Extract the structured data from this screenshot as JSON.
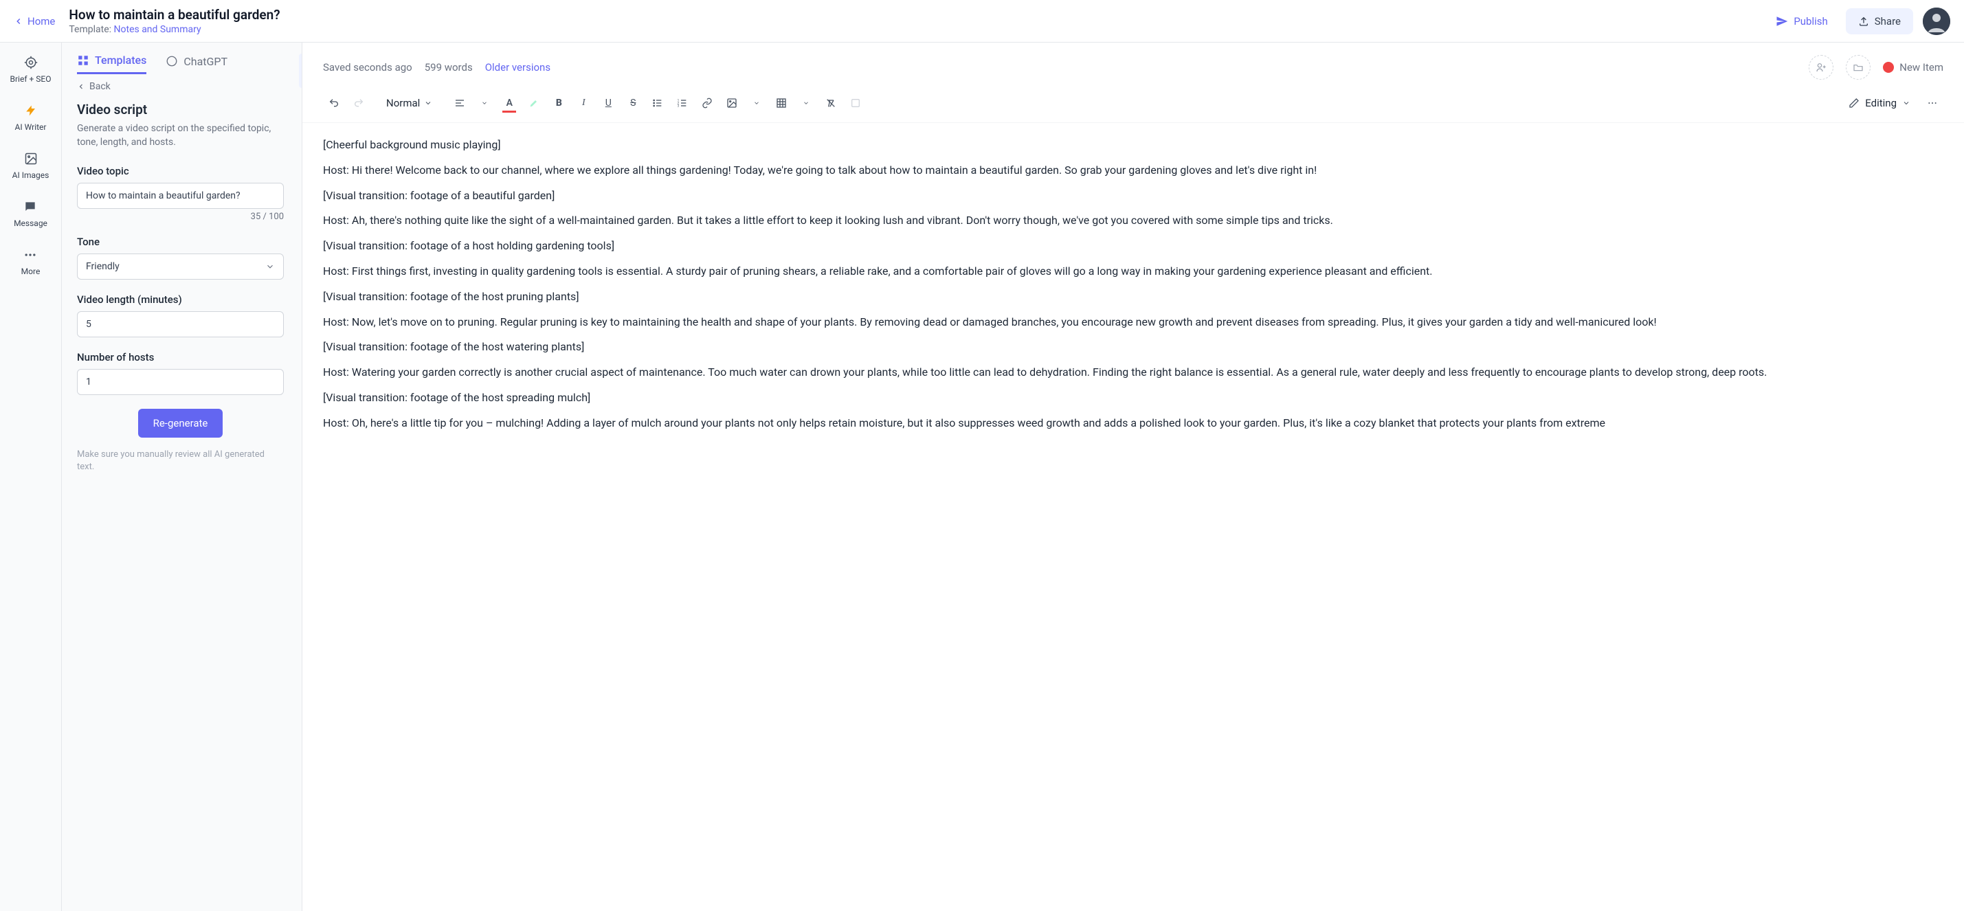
{
  "header": {
    "home": "Home",
    "title": "How to maintain a beautiful garden?",
    "template_prefix": "Template: ",
    "template_link": "Notes and Summary",
    "publish": "Publish",
    "share": "Share"
  },
  "rail": {
    "items": [
      {
        "label": "Brief + SEO"
      },
      {
        "label": "AI Writer"
      },
      {
        "label": "AI Images"
      },
      {
        "label": "Message"
      },
      {
        "label": "More"
      }
    ]
  },
  "panel": {
    "tabs": {
      "templates": "Templates",
      "chatgpt": "ChatGPT"
    },
    "back": "Back",
    "title": "Video script",
    "desc": "Generate a video script on the specified topic, tone, length, and hosts.",
    "topic_label": "Video topic",
    "topic_value": "How to maintain a beautiful garden?",
    "char_count": "35 / 100",
    "tone_label": "Tone",
    "tone_value": "Friendly",
    "length_label": "Video length (minutes)",
    "length_value": "5",
    "hosts_label": "Number of hosts",
    "hosts_value": "1",
    "regen": "Re-generate",
    "disclaimer": "Make sure you manually review all AI generated text."
  },
  "status": {
    "saved": "Saved seconds ago",
    "words": "599 words",
    "older": "Older versions",
    "new_item": "New Item"
  },
  "toolbar": {
    "style": "Normal",
    "editing": "Editing"
  },
  "doc": {
    "p1": "[Cheerful background music playing]",
    "p2": "Host: Hi there! Welcome back to our channel, where we explore all things gardening! Today, we're going to talk about how to maintain a beautiful garden. So grab your gardening gloves and let's dive right in!",
    "p3": "[Visual transition: footage of a beautiful garden]",
    "p4": "Host: Ah, there's nothing quite like the sight of a well-maintained garden. But it takes a little effort to keep it looking lush and vibrant. Don't worry though, we've got you covered with some simple tips and tricks.",
    "p5": "[Visual transition: footage of a host holding gardening tools]",
    "p6": "Host: First things first, investing in quality gardening tools is essential. A sturdy pair of pruning shears, a reliable rake, and a comfortable pair of gloves will go a long way in making your gardening experience pleasant and efficient.",
    "p7": "[Visual transition: footage of the host pruning plants]",
    "p8": "Host: Now, let's move on to pruning. Regular pruning is key to maintaining the health and shape of your plants. By removing dead or damaged branches, you encourage new growth and prevent diseases from spreading. Plus, it gives your garden a tidy and well-manicured look!",
    "p9": "[Visual transition: footage of the host watering plants]",
    "p10": "Host: Watering your garden correctly is another crucial aspect of maintenance. Too much water can drown your plants, while too little can lead to dehydration. Finding the right balance is essential. As a general rule, water deeply and less frequently to encourage plants to develop strong, deep roots.",
    "p11": "[Visual transition: footage of the host spreading mulch]",
    "p12": "Host: Oh, here's a little tip for you – mulching! Adding a layer of mulch around your plants not only helps retain moisture, but it also suppresses weed growth and adds a polished look to your garden. Plus, it's like a cozy blanket that protects your plants from extreme"
  }
}
